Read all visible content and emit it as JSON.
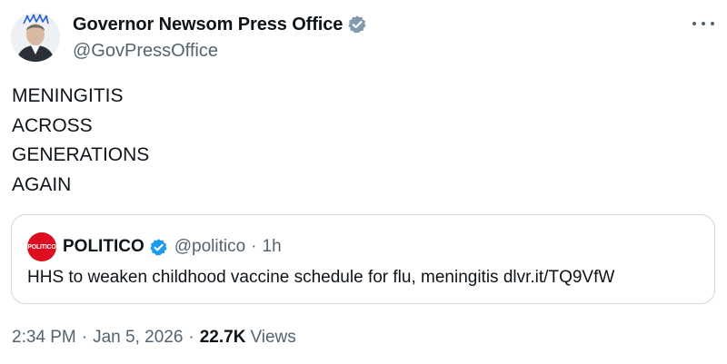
{
  "author": {
    "display_name": "Governor Newsom Press Office",
    "handle": "@GovPressOffice",
    "verified_badge": "grey-verified-icon"
  },
  "tweet": {
    "lines": [
      "MENINGITIS",
      "ACROSS",
      "GENERATIONS",
      "AGAIN"
    ]
  },
  "quoted": {
    "logo_text": "POLITICO",
    "display_name": "POLITICO",
    "verified_badge": "blue-verified-icon",
    "handle": "@politico",
    "separator": "·",
    "time": "1h",
    "text": "HHS to weaken childhood vaccine schedule for flu, meningitis dlvr.it/TQ9VfW"
  },
  "meta": {
    "time": "2:34 PM",
    "separator": "·",
    "date": "Jan 5, 2026",
    "views_count": "22.7K",
    "views_label": "Views"
  },
  "colors": {
    "text": "#0f1419",
    "secondary": "#536471",
    "border": "#cfd9de",
    "politico_red": "#dc0d1e",
    "verified_blue": "#1d9bf0",
    "verified_grey": "#829aab"
  }
}
